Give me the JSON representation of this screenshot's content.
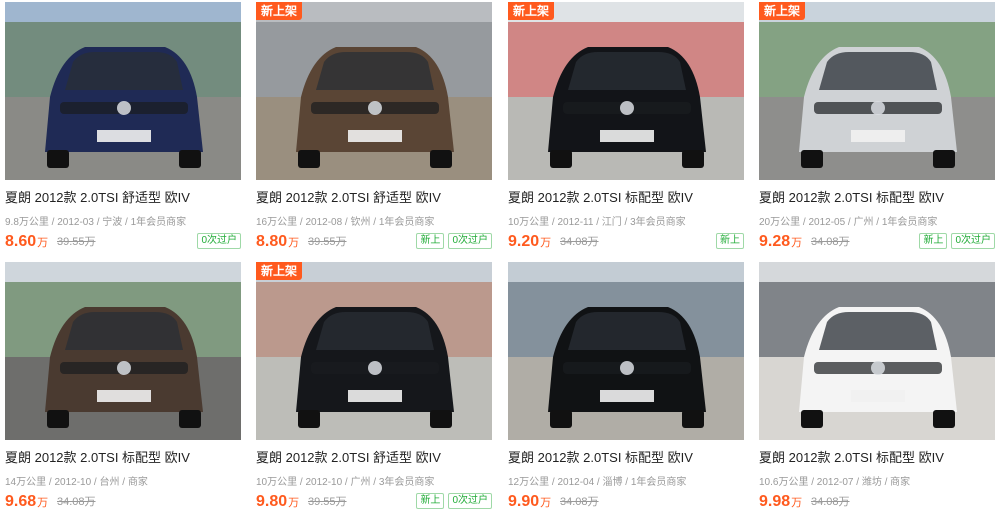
{
  "listings": [
    {
      "new_badge": "",
      "title": "夏朗 2012款 2.0TSI 舒适型 欧IV",
      "meta": "9.8万公里 / 2012-03 / 宁波 / 1年会员商家",
      "price": "8.60",
      "price_unit": "万",
      "original_price": "39.55万",
      "tags": [
        "0次过户"
      ],
      "photo": {
        "sky": "#9fb6cf",
        "ground": "#8a8a86",
        "car": "#1f2a55",
        "bg": "#4f6a3d"
      }
    },
    {
      "new_badge": "新上架",
      "title": "夏朗 2012款 2.0TSI 舒适型 欧IV",
      "meta": "16万公里 / 2012-08 / 钦州 / 1年会员商家",
      "price": "8.80",
      "price_unit": "万",
      "original_price": "39.55万",
      "tags": [
        "新上",
        "0次过户"
      ],
      "photo": {
        "sky": "#b9bcc0",
        "ground": "#9a8f7f",
        "car": "#5a4535",
        "bg": "#7a7d82"
      }
    },
    {
      "new_badge": "新上架",
      "title": "夏朗 2012款 2.0TSI 标配型 欧IV",
      "meta": "10万公里 / 2012-11 / 江门 / 3年会员商家",
      "price": "9.20",
      "price_unit": "万",
      "original_price": "34.08万",
      "tags": [
        "新上"
      ],
      "photo": {
        "sky": "#dfe3e6",
        "ground": "#b9b9b5",
        "car": "#121418",
        "bg": "#c23a35"
      }
    },
    {
      "new_badge": "新上架",
      "title": "夏朗 2012款 2.0TSI 标配型 欧IV",
      "meta": "20万公里 / 2012-05 / 广州 / 1年会员商家",
      "price": "9.28",
      "price_unit": "万",
      "original_price": "34.08万",
      "tags": [
        "新上",
        "0次过户"
      ],
      "photo": {
        "sky": "#c9d3dc",
        "ground": "#8e8e8c",
        "car": "#cfd2d5",
        "bg": "#4b7a3b"
      }
    },
    {
      "new_badge": "",
      "title": "夏朗 2012款 2.0TSI 标配型 欧IV",
      "meta": "14万公里 / 2012-10 / 台州 / 商家",
      "price": "9.68",
      "price_unit": "万",
      "original_price": "34.08万",
      "tags": [],
      "photo": {
        "sky": "#cfd6dc",
        "ground": "#6e6e6c",
        "car": "#4a3a30",
        "bg": "#3f6a34"
      }
    },
    {
      "new_badge": "新上架",
      "title": "夏朗 2012款 2.0TSI 舒适型 欧IV",
      "meta": "10万公里 / 2012-10 / 广州 / 3年会员商家",
      "price": "9.80",
      "price_unit": "万",
      "original_price": "39.55万",
      "tags": [
        "新上",
        "0次过户"
      ],
      "photo": {
        "sky": "#c8cfd6",
        "ground": "#bdbdb8",
        "car": "#15171b",
        "bg": "#b06e52"
      }
    },
    {
      "new_badge": "",
      "title": "夏朗 2012款 2.0TSI 标配型 欧IV",
      "meta": "12万公里 / 2012-04 / 淄博 / 1年会员商家",
      "price": "9.90",
      "price_unit": "万",
      "original_price": "34.08万",
      "tags": [],
      "photo": {
        "sky": "#c3ccd4",
        "ground": "#b0ada6",
        "car": "#101214",
        "bg": "#51606e"
      }
    },
    {
      "new_badge": "",
      "title": "夏朗 2012款 2.0TSI 标配型 欧IV",
      "meta": "10.6万公里 / 2012-07 / 潍坊 / 商家",
      "price": "9.98",
      "price_unit": "万",
      "original_price": "34.08万",
      "tags": [],
      "photo": {
        "sky": "#d5d8db",
        "ground": "#d8d6d2",
        "car": "#f4f4f4",
        "bg": "#3a3f46"
      }
    }
  ]
}
